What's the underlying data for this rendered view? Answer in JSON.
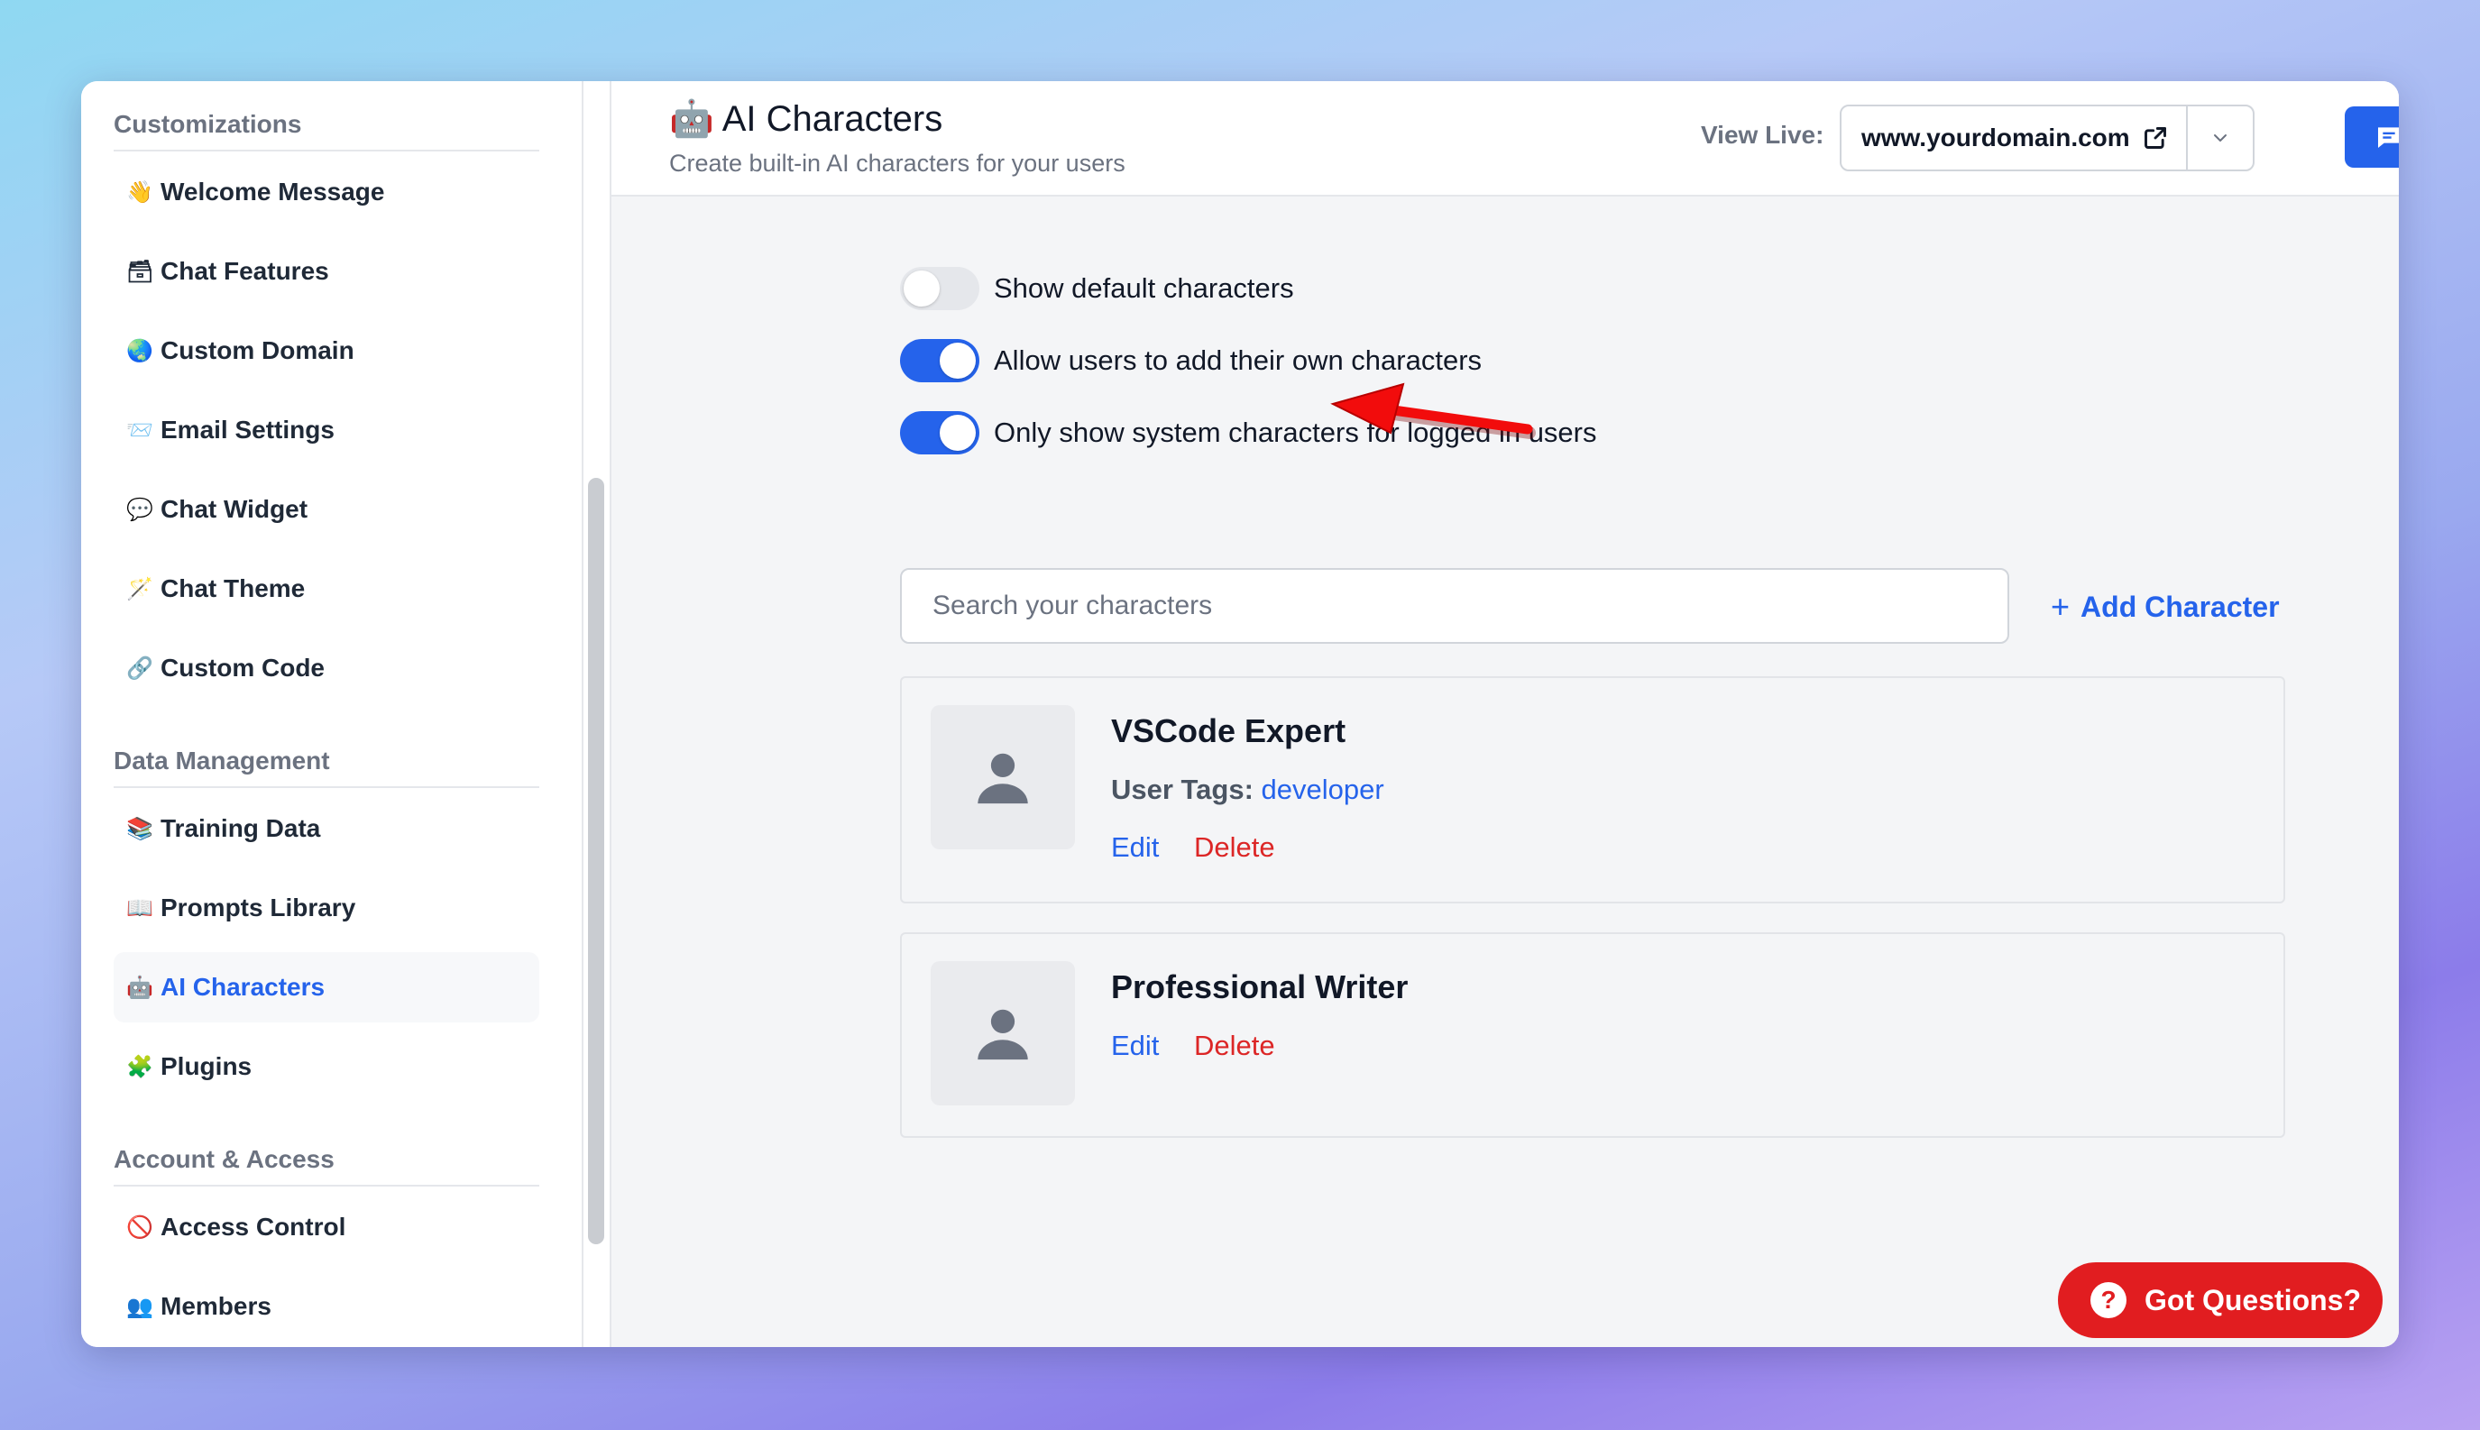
{
  "sidebar": {
    "sections": [
      {
        "heading": "Customizations",
        "items": [
          {
            "emoji": "👋",
            "label": "Welcome Message"
          },
          {
            "emoji": "🗃",
            "label": "Chat Features"
          },
          {
            "emoji": "🌏",
            "label": "Custom Domain"
          },
          {
            "emoji": "📨",
            "label": "Email Settings"
          },
          {
            "emoji": "💬",
            "label": "Chat Widget"
          },
          {
            "emoji": "🪄",
            "label": "Chat Theme"
          },
          {
            "emoji": "🔗",
            "label": "Custom Code"
          }
        ]
      },
      {
        "heading": "Data Management",
        "items": [
          {
            "emoji": "📚",
            "label": "Training Data"
          },
          {
            "emoji": "📖",
            "label": "Prompts Library"
          },
          {
            "emoji": "🤖",
            "label": "AI Characters",
            "active": true
          },
          {
            "emoji": "🧩",
            "label": "Plugins"
          }
        ]
      },
      {
        "heading": "Account & Access",
        "items": [
          {
            "emoji": "🚫",
            "label": "Access Control"
          },
          {
            "emoji": "👥",
            "label": "Members"
          }
        ]
      }
    ]
  },
  "header": {
    "title_emoji": "🤖",
    "title": "AI Characters",
    "subtitle": "Create built-in AI characters for your users",
    "view_live_label": "View Live:",
    "domain": "www.yourdomain.com"
  },
  "toggles": [
    {
      "label": "Show default characters",
      "on": false
    },
    {
      "label": "Allow users to add their own characters",
      "on": true
    },
    {
      "label": "Only show system characters for logged in users",
      "on": true
    }
  ],
  "search": {
    "placeholder": "Search your characters"
  },
  "add_character_label": "Add Character",
  "characters": [
    {
      "name": "VSCode Expert",
      "tags_label": "User Tags:",
      "tags_value": "developer",
      "edit": "Edit",
      "delete": "Delete"
    },
    {
      "name": "Professional Writer",
      "edit": "Edit",
      "delete": "Delete"
    }
  ],
  "help_button": {
    "icon": "?",
    "label": "Got Questions?"
  },
  "colors": {
    "accent": "#2563eb",
    "danger": "#dc2626",
    "help": "#e11d20"
  }
}
